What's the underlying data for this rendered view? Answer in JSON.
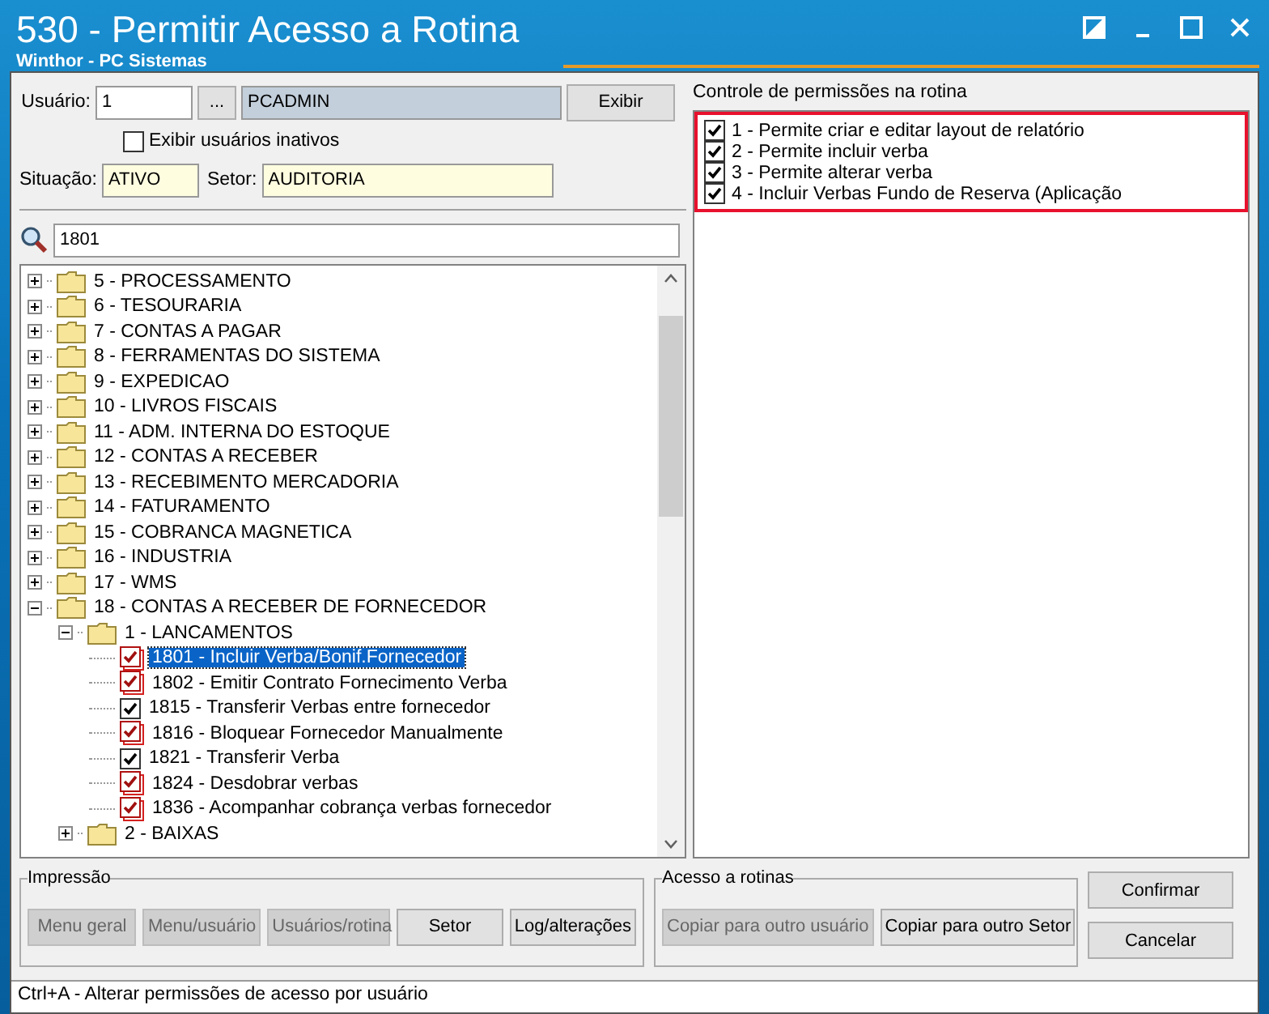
{
  "window": {
    "title": "530 - Permitir Acesso a Rotina",
    "subtitle": "Winthor - PC Sistemas"
  },
  "user": {
    "label": "Usuário:",
    "code": "1",
    "lookup": "...",
    "name": "PCADMIN",
    "show_button": "Exibir",
    "show_inactive": {
      "label": "Exibir usuários inativos",
      "checked": false
    }
  },
  "status": {
    "label": "Situação:",
    "value": "ATIVO"
  },
  "sector": {
    "label": "Setor:",
    "value": "AUDITORIA"
  },
  "search": {
    "value": "1801"
  },
  "tree": [
    {
      "label": "5 - PROCESSAMENTO",
      "expanded": false
    },
    {
      "label": "6 - TESOURARIA",
      "expanded": false
    },
    {
      "label": "7 - CONTAS A PAGAR",
      "expanded": false
    },
    {
      "label": "8 - FERRAMENTAS DO SISTEMA",
      "expanded": false
    },
    {
      "label": "9 - EXPEDICAO",
      "expanded": false
    },
    {
      "label": "10 - LIVROS FISCAIS",
      "expanded": false
    },
    {
      "label": "11 - ADM. INTERNA DO ESTOQUE",
      "expanded": false
    },
    {
      "label": "12 - CONTAS A RECEBER",
      "expanded": false
    },
    {
      "label": "13 - RECEBIMENTO MERCADORIA",
      "expanded": false
    },
    {
      "label": "14 - FATURAMENTO",
      "expanded": false
    },
    {
      "label": "15 - COBRANCA MAGNETICA",
      "expanded": false
    },
    {
      "label": "16 - INDUSTRIA",
      "expanded": false
    },
    {
      "label": "17 - WMS",
      "expanded": false
    },
    {
      "label": "18 - CONTAS A RECEBER DE FORNECEDOR",
      "expanded": true,
      "children": [
        {
          "label": "1 - LANCAMENTOS",
          "expanded": true,
          "children": [
            {
              "label": "1801 - Incluir Verba/Bonif.Fornecedor",
              "checked": true,
              "kind": "stacked",
              "selected": true
            },
            {
              "label": "1802 - Emitir Contrato Fornecimento Verba",
              "checked": true,
              "kind": "stacked",
              "selected": false
            },
            {
              "label": "1815 - Transferir Verbas entre fornecedor",
              "checked": true,
              "kind": "single",
              "selected": false
            },
            {
              "label": "1816 - Bloquear Fornecedor Manualmente",
              "checked": true,
              "kind": "stacked",
              "selected": false
            },
            {
              "label": "1821 - Transferir Verba",
              "checked": true,
              "kind": "single",
              "selected": false
            },
            {
              "label": "1824 - Desdobrar verbas",
              "checked": true,
              "kind": "stacked",
              "selected": false
            },
            {
              "label": "1836 - Acompanhar cobrança verbas fornecedor",
              "checked": true,
              "kind": "stacked",
              "selected": false
            }
          ]
        },
        {
          "label": "2 - BAIXAS",
          "expanded": false
        }
      ]
    }
  ],
  "permissions": {
    "title": "Controle de permissões na rotina",
    "items": [
      {
        "label": "1 - Permite criar e editar layout de relatório",
        "checked": true
      },
      {
        "label": "2 - Permite incluir verba",
        "checked": true
      },
      {
        "label": "3 - Permite alterar verba",
        "checked": true
      },
      {
        "label": "4 - Incluir Verbas Fundo de Reserva (Aplicação",
        "checked": true
      }
    ]
  },
  "print_group": {
    "title": "Impressão",
    "buttons": [
      {
        "label": "Menu geral",
        "disabled": true
      },
      {
        "label": "Menu/usuário",
        "disabled": true
      },
      {
        "label": "Usuários/rotina",
        "disabled": true
      },
      {
        "label": "Setor",
        "disabled": false
      },
      {
        "label": "Log/alterações",
        "disabled": false
      }
    ]
  },
  "access_group": {
    "title": "Acesso a rotinas",
    "buttons": [
      {
        "label": "Copiar para outro usuário",
        "disabled": true
      },
      {
        "label": "Copiar para outro Setor",
        "disabled": false
      }
    ]
  },
  "actions": [
    {
      "label": "Confirmar",
      "disabled": false
    },
    {
      "label": "Cancelar",
      "disabled": false
    }
  ],
  "status_bar": "Ctrl+A - Alterar permissões de acesso por usuário"
}
